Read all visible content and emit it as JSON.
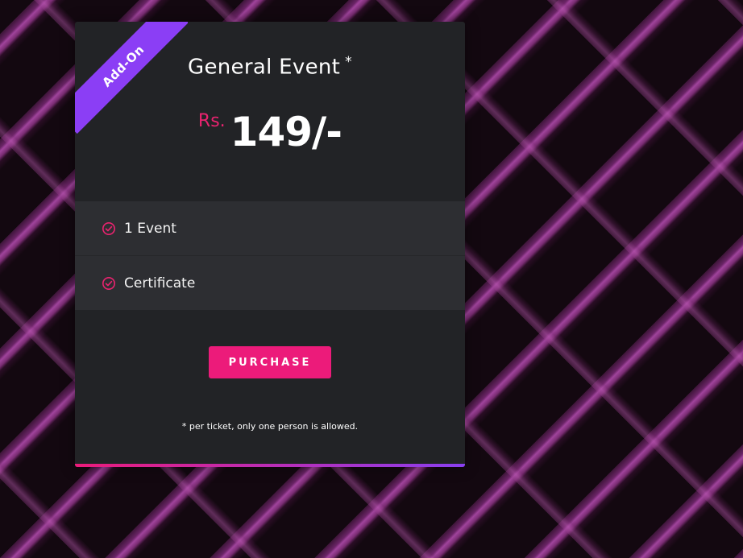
{
  "card": {
    "ribbon_label": "Add-On",
    "title": "General Event",
    "title_marker": "*",
    "currency": "Rs.",
    "price": "149/-",
    "features": [
      {
        "label": "1 Event",
        "icon": "check-circle-icon"
      },
      {
        "label": "Certificate",
        "icon": "check-circle-icon"
      }
    ],
    "purchase_label": "PURCHASE",
    "footnote": "* per ticket, only one person is allowed."
  },
  "colors": {
    "accent_pink": "#ec1b7a",
    "ribbon_purple": "#8b3ef5",
    "card_bg": "#222326",
    "feature_bg": "#2d2e32"
  }
}
